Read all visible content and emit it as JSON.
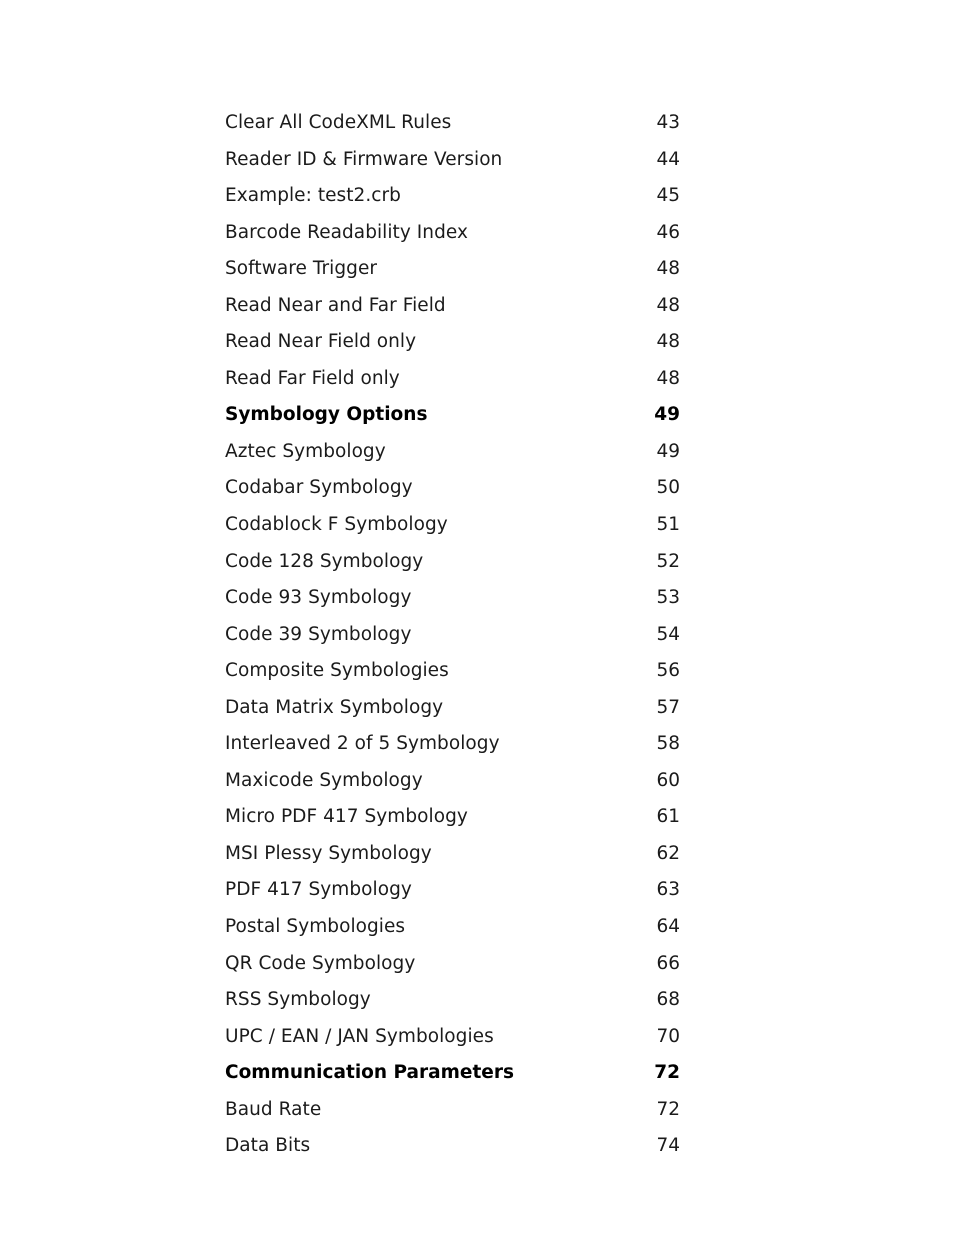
{
  "document": {
    "type": "table-of-contents",
    "page_background": "#ffffff",
    "text_color": "#1b1b1b",
    "section_color": "#000000"
  },
  "toc": {
    "entries": [
      {
        "title": "Clear All CodeXML Rules",
        "page": "43",
        "section": false
      },
      {
        "title": "Reader ID & Firmware Version",
        "page": "44",
        "section": false
      },
      {
        "title": "Example: test2.crb",
        "page": "45",
        "section": false
      },
      {
        "title": "Barcode Readability Index",
        "page": "46",
        "section": false
      },
      {
        "title": "Software Trigger",
        "page": "48",
        "section": false
      },
      {
        "title": "Read Near and Far Field",
        "page": "48",
        "section": false
      },
      {
        "title": "Read Near Field only",
        "page": "48",
        "section": false
      },
      {
        "title": "Read Far Field only",
        "page": "48",
        "section": false
      },
      {
        "title": "Symbology Options",
        "page": "49",
        "section": true
      },
      {
        "title": "Aztec Symbology",
        "page": "49",
        "section": false
      },
      {
        "title": "Codabar Symbology",
        "page": "50",
        "section": false
      },
      {
        "title": "Codablock F Symbology",
        "page": "51",
        "section": false
      },
      {
        "title": "Code 128 Symbology",
        "page": "52",
        "section": false
      },
      {
        "title": "Code 93 Symbology",
        "page": "53",
        "section": false
      },
      {
        "title": "Code 39 Symbology",
        "page": "54",
        "section": false
      },
      {
        "title": "Composite Symbologies",
        "page": "56",
        "section": false
      },
      {
        "title": "Data Matrix Symbology",
        "page": "57",
        "section": false
      },
      {
        "title": "Interleaved 2 of 5 Symbology",
        "page": "58",
        "section": false
      },
      {
        "title": "Maxicode Symbology",
        "page": "60",
        "section": false
      },
      {
        "title": "Micro PDF 417 Symbology",
        "page": "61",
        "section": false
      },
      {
        "title": "MSI Plessy Symbology",
        "page": "62",
        "section": false
      },
      {
        "title": "PDF 417 Symbology",
        "page": "63",
        "section": false
      },
      {
        "title": "Postal Symbologies",
        "page": "64",
        "section": false
      },
      {
        "title": "QR Code Symbology",
        "page": "66",
        "section": false
      },
      {
        "title": "RSS Symbology",
        "page": "68",
        "section": false
      },
      {
        "title": "UPC / EAN / JAN Symbologies",
        "page": "70",
        "section": false
      },
      {
        "title": "Communication Parameters",
        "page": "72",
        "section": true
      },
      {
        "title": "Baud Rate",
        "page": "72",
        "section": false
      },
      {
        "title": "Data Bits",
        "page": "74",
        "section": false
      }
    ]
  }
}
